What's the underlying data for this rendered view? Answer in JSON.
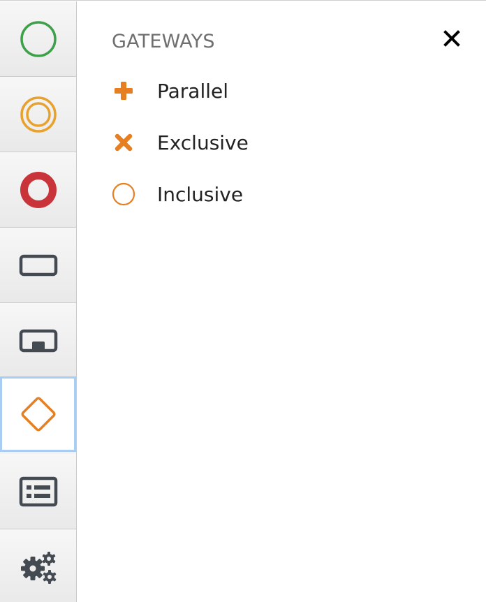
{
  "colors": {
    "start": "#3fa04a",
    "intermediate": "#e8a12d",
    "end": "#c9343a",
    "dark": "#444a52",
    "gateway": "#e67e22",
    "active_border": "#a9cdf2"
  },
  "sidebar": {
    "items": [
      {
        "name": "start-event",
        "icon": "circle-thin-icon"
      },
      {
        "name": "intermediate-event",
        "icon": "double-circle-icon"
      },
      {
        "name": "end-event",
        "icon": "circle-thick-icon"
      },
      {
        "name": "task",
        "icon": "rectangle-icon"
      },
      {
        "name": "subprocess",
        "icon": "rectangle-marker-icon"
      },
      {
        "name": "gateway",
        "icon": "diamond-icon",
        "active": true
      },
      {
        "name": "data-object",
        "icon": "list-icon"
      },
      {
        "name": "settings",
        "icon": "gears-icon"
      }
    ]
  },
  "panel": {
    "title": "GATEWAYS",
    "close_icon": "close-icon",
    "items": [
      {
        "label": "Parallel",
        "icon": "plus-icon"
      },
      {
        "label": "Exclusive",
        "icon": "x-icon"
      },
      {
        "label": "Inclusive",
        "icon": "circle-icon"
      }
    ]
  }
}
